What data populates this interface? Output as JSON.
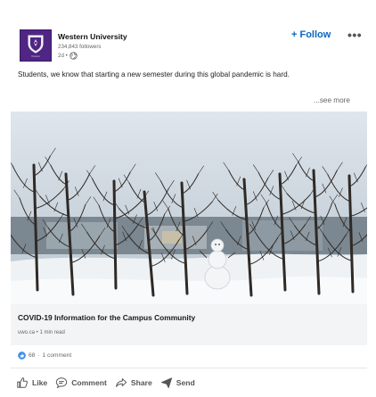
{
  "post": {
    "author": {
      "name": "Western University",
      "followers": "234,843 followers",
      "age": "2d •",
      "logo_text": "Western"
    },
    "follow_label": "+ Follow",
    "more_label": "•••",
    "text": "Students, we know that starting a new semester during this global pandemic is hard.",
    "see_more_label": "...see more",
    "image": {
      "subject": "snowy campus trees with a snowman"
    },
    "link_card": {
      "title": "COVID-19 Information for the Campus Community",
      "meta": "uwo.ca • 1 min read"
    },
    "reactions": {
      "count": "68",
      "separator": "·",
      "comments": "1 comment"
    },
    "actions": [
      {
        "label": "Like",
        "icon": "thumbs-up-icon"
      },
      {
        "label": "Comment",
        "icon": "comment-icon"
      },
      {
        "label": "Share",
        "icon": "share-icon"
      },
      {
        "label": "Send",
        "icon": "send-icon"
      }
    ],
    "colors": {
      "brand_purple": "#4f2683",
      "link_blue": "#0a66c2",
      "like_blue": "#378fe9"
    }
  }
}
